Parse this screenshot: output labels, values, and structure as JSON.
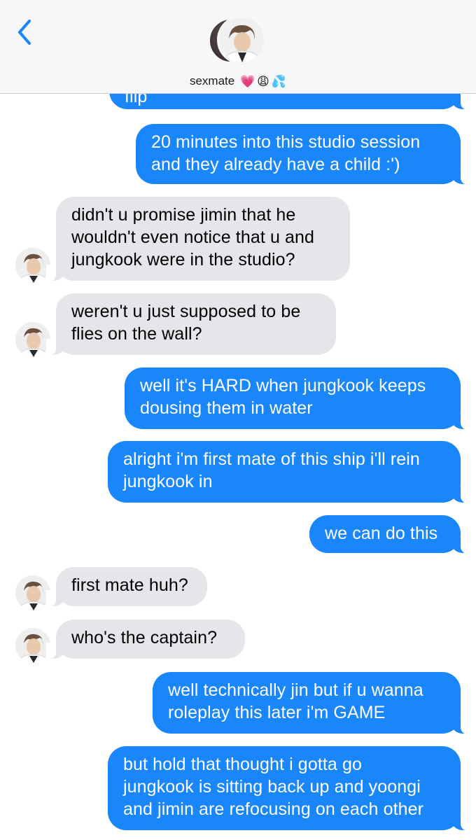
{
  "header": {
    "contact_name": "sexmate",
    "emojis": [
      "💗",
      "😩",
      "💦"
    ],
    "icons": [
      "chevron-left-icon",
      "contact-avatar"
    ]
  },
  "messages": [
    {
      "type": "sent",
      "text": "flip"
    },
    {
      "type": "sent",
      "text": "20 minutes into this studio session\nand they already have a child :')"
    },
    {
      "type": "received",
      "text": "didn't u promise jimin that he\nwouldn't even notice that u and\njungkook were in the studio?"
    },
    {
      "type": "received",
      "text": "weren't u just supposed to be\nflies on the wall?"
    },
    {
      "type": "sent",
      "text": "well it's HARD when jungkook keeps\ndousing them in water"
    },
    {
      "type": "sent",
      "text": "alright i'm first mate of this ship i'll rein\njungkook in"
    },
    {
      "type": "sent",
      "text": "we can do this"
    },
    {
      "type": "received",
      "text": "first mate huh?"
    },
    {
      "type": "received",
      "text": "who's the captain?"
    },
    {
      "type": "sent",
      "text": "well technically jin but if u wanna\nroleplay this later i'm GAME"
    },
    {
      "type": "sent",
      "text": "but hold that thought i gotta go\njungkook is sitting back up and yoongi\nand jimin are refocusing on each other"
    }
  ],
  "colors": {
    "sent_bubble": "#1a86fb",
    "received_bubble": "#e6e5ea",
    "header_bg": "#f7f7f9",
    "accent": "#1a86fb"
  }
}
